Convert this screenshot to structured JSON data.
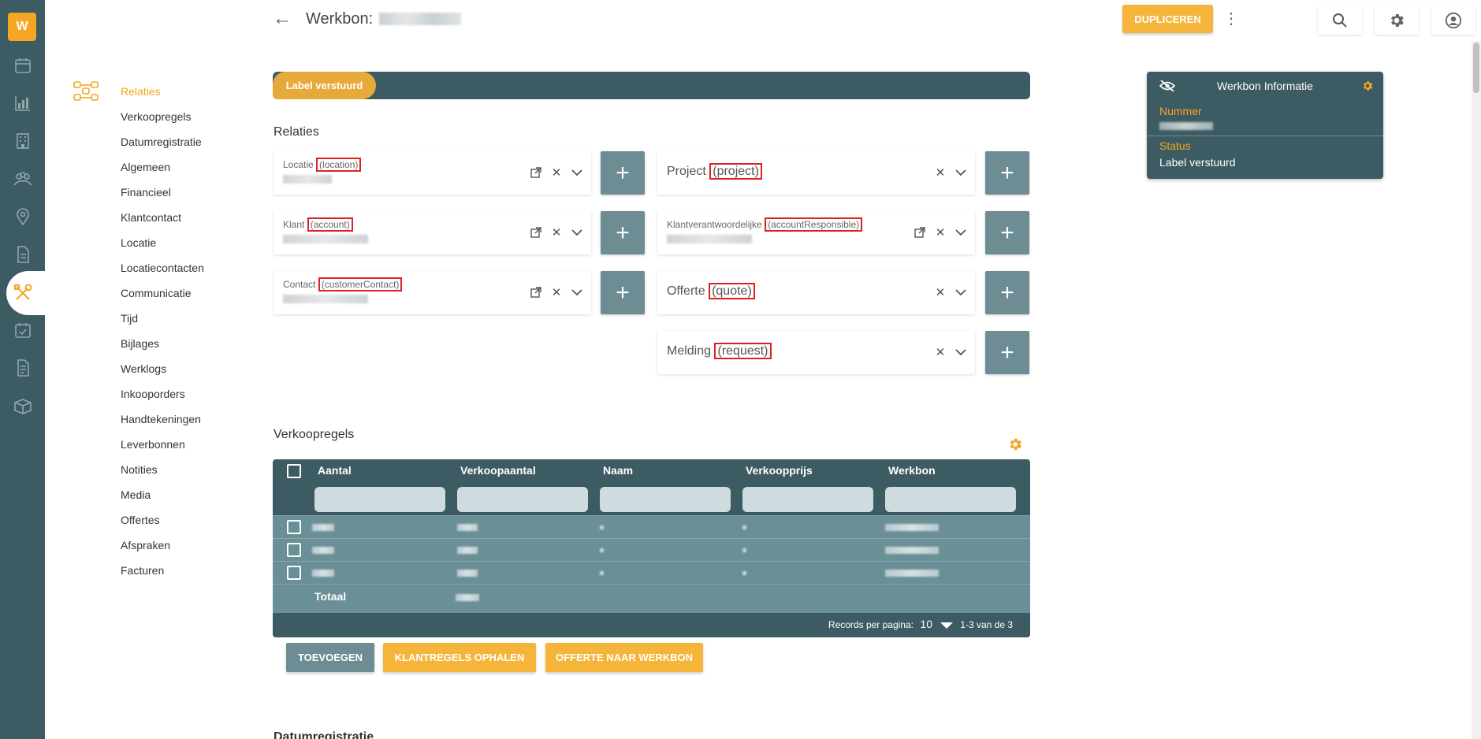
{
  "app": {
    "logo_text": "W"
  },
  "colors": {
    "accent": "#f5a623",
    "rail": "#3d5b62",
    "table_row": "#6b8f96",
    "highlight": "#e02020"
  },
  "rail": {
    "icons": [
      "calendar-icon",
      "chart-icon",
      "building-icon",
      "people-icon",
      "location-icon",
      "document-icon",
      "tools-icon",
      "checklist-icon",
      "invoice-icon",
      "box-icon"
    ],
    "active": "tools-icon"
  },
  "subnav": {
    "icon": "relations-icon",
    "items": [
      "Relaties",
      "Verkoopregels",
      "Datumregistratie",
      "Algemeen",
      "Financieel",
      "Klantcontact",
      "Locatie",
      "Locatiecontacten",
      "Communicatie",
      "Tijd",
      "Bijlages",
      "Werklogs",
      "Inkooporders",
      "Handtekeningen",
      "Leverbonnen",
      "Notities",
      "Media",
      "Offertes",
      "Afspraken",
      "Facturen"
    ],
    "active_index": 0
  },
  "header": {
    "title": "Werkbon:",
    "duplicate_label": "DUPLICEREN"
  },
  "status": {
    "pill": "Label verstuurd"
  },
  "relations": {
    "title": "Relaties",
    "left": [
      {
        "label": "Locatie",
        "key": "(location)"
      },
      {
        "label": "Klant",
        "key": "(account)"
      },
      {
        "label": "Contact",
        "key": "(customerContact)"
      }
    ],
    "right": [
      {
        "label": "Project",
        "key": "(project)"
      },
      {
        "label": "Klantverantwoordelijke",
        "key": "(accountResponsible)"
      },
      {
        "label": "Offerte",
        "key": "(quote)"
      },
      {
        "label": "Melding",
        "key": "(request)"
      }
    ],
    "plus": "+"
  },
  "info": {
    "title": "Werkbon Informatie",
    "nummer_label": "Nummer",
    "status_label": "Status",
    "status_value": "Label verstuurd"
  },
  "sales": {
    "title": "Verkoopregels",
    "columns": [
      "Aantal",
      "Verkoopaantal",
      "Naam",
      "Verkoopprijs",
      "Werkbon"
    ],
    "total_label": "Totaal",
    "records_per_page_label": "Records per pagina:",
    "records_per_page": "10",
    "range": "1-3 van de 3",
    "buttons": {
      "add": "TOEVOEGEN",
      "fetch": "KLANTREGELS OPHALEN",
      "quote": "OFFERTE NAAR WERKBON"
    }
  },
  "next_section": "Datumregistratie"
}
